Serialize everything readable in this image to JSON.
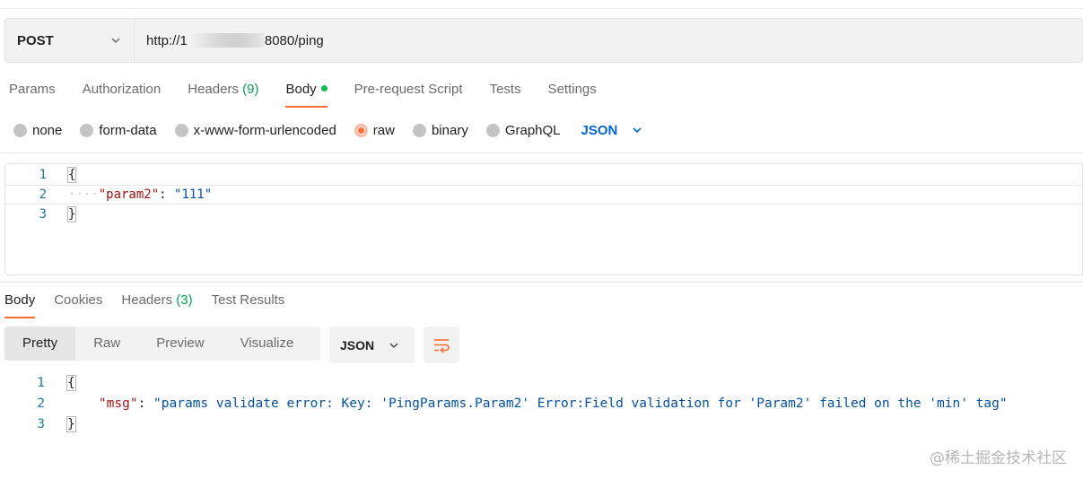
{
  "request": {
    "method": "POST",
    "url_start": "http://1",
    "url_end": "8080/ping"
  },
  "request_tabs": [
    {
      "label": "Params"
    },
    {
      "label": "Authorization"
    },
    {
      "label": "Headers",
      "count": "(9)"
    },
    {
      "label": "Body"
    },
    {
      "label": "Pre-request Script"
    },
    {
      "label": "Tests"
    },
    {
      "label": "Settings"
    }
  ],
  "body_types": [
    {
      "label": "none"
    },
    {
      "label": "form-data"
    },
    {
      "label": "x-www-form-urlencoded"
    },
    {
      "label": "raw",
      "selected": true
    },
    {
      "label": "binary"
    },
    {
      "label": "GraphQL"
    }
  ],
  "body_language": "JSON",
  "request_body": {
    "line_numbers": [
      "1",
      "2",
      "3"
    ],
    "open": "{",
    "indent_dots": "····",
    "key": "\"param2\"",
    "colon": ": ",
    "value": "\"111\"",
    "close": "}"
  },
  "response_tabs": [
    {
      "label": "Body"
    },
    {
      "label": "Cookies"
    },
    {
      "label": "Headers",
      "count": "(3)"
    },
    {
      "label": "Test Results"
    }
  ],
  "view_modes": [
    {
      "label": "Pretty"
    },
    {
      "label": "Raw"
    },
    {
      "label": "Preview"
    },
    {
      "label": "Visualize"
    }
  ],
  "response_format": "JSON",
  "response_body": {
    "line_numbers": [
      "1",
      "2",
      "3"
    ],
    "open": "{",
    "key": "\"msg\"",
    "colon": ": ",
    "value": "\"params validate error: Key: 'PingParams.Param2' Error:Field validation for 'Param2' failed on the 'min' tag\"",
    "close": "}"
  },
  "watermark": "@稀土掘金技术社区",
  "colors": {
    "accent": "#ff6c37",
    "link_blue": "#0265d2",
    "count_green": "#0c9d58",
    "dot_green": "#0cbb52",
    "json_key": "#a31515",
    "json_string": "#0451a5"
  }
}
